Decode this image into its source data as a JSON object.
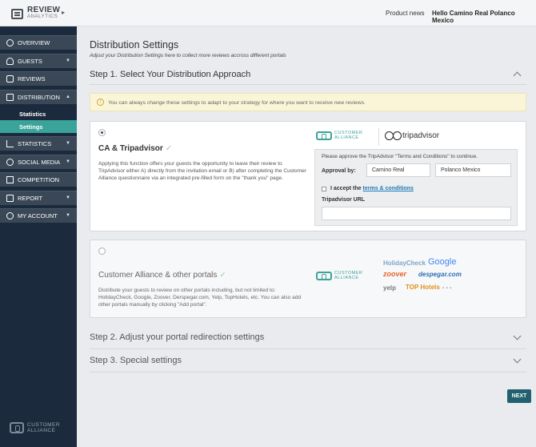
{
  "brand": {
    "name": "REVIEW",
    "sub": "ANALYTICS",
    "collapse_icon": "caret-right-icon"
  },
  "topbar": {
    "product_news": "Product news",
    "greeting": "Hello Camino Real Polanco Mexico"
  },
  "sidebar": {
    "items": [
      {
        "label": "OVERVIEW",
        "icon": "dashboard-icon"
      },
      {
        "label": "GUESTS",
        "icon": "user-icon"
      },
      {
        "label": "REVIEWS",
        "icon": "chat-icon"
      },
      {
        "label": "DISTRIBUTION",
        "icon": "share-icon"
      },
      {
        "label": "STATISTICS",
        "icon": "bar-chart-icon"
      },
      {
        "label": "SOCIAL MEDIA",
        "icon": "globe-icon"
      },
      {
        "label": "COMPETITION",
        "icon": "competition-icon"
      },
      {
        "label": "REPORT",
        "icon": "report-icon"
      },
      {
        "label": "MY ACCOUNT",
        "icon": "account-icon"
      }
    ],
    "sub_items": [
      {
        "label": "Statistics"
      },
      {
        "label": "Settings",
        "active": true
      }
    ],
    "footer": {
      "line1": "CUSTOMER",
      "line2": "ALLIANCE"
    }
  },
  "main": {
    "title": "Distribution Settings",
    "subtitle": "Adjust your Distribution Settings here to collect more reviews accross different portals",
    "step1": "Step 1. Select Your Distribution Approach",
    "info": "You can always change these settings to adapt to your strategy for where you want to receive new reviews.",
    "option1": {
      "title": "CA & Tripadvisor",
      "desc": "Applying this function offers your guests the opportunity to leave their review to TripAdvisor either A) directly from the invitation email or B) after completing the Customer Alliance questionnaire via an integrated pre-filled form on the \"thank you\" page.",
      "ca_logo_line1": "CUSTOMER",
      "ca_logo_line2": "ALLIANCE",
      "ta_logo": "tripadvisor",
      "approval_note": "Please approve the TripAdvisor \"Terms and Conditions\" to continue.",
      "approval_label": "Approval by:",
      "first_name": "Camino Real",
      "last_name": "Polanco Mexico",
      "accept_text": "I accept the",
      "accept_link": "terms & conditions",
      "url_label": "Tripadvisor URL",
      "url_value": ""
    },
    "option2": {
      "title": "Customer Alliance & other portals",
      "desc": "Distribute your guests to review on other portals including, but not limited to: HolidayCheck, Google, Zoover, Derspegar.com, Yelp, TopHotels, etc. You can also add other portals manually by clicking \"Add portal\".",
      "ca_logo_line1": "CUSTOMER",
      "ca_logo_line2": "ALLIANCE",
      "portals": {
        "holidaycheck": "HolidayCheck",
        "google": "Google",
        "zoover": "zoover",
        "despegar": "despegar.com",
        "yelp": "yelp",
        "tophotels": "TOP Hotels",
        "more": "..."
      }
    },
    "step2": "Step 2. Adjust your portal redirection settings",
    "step3": "Step 3. Special settings",
    "next_label": "NEXT"
  }
}
